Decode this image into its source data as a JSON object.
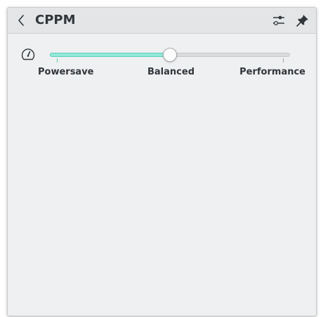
{
  "header": {
    "title": "CPPM",
    "back_icon": "chevron-left-icon",
    "settings_icon": "sliders-icon",
    "pin_icon": "pin-icon"
  },
  "profile_slider": {
    "icon": "speedometer-icon",
    "options": [
      "Powersave",
      "Balanced",
      "Performance"
    ],
    "selected": "Balanced",
    "value_fraction": 0.5,
    "colors": {
      "fill": "#93e8d8",
      "fill_border": "#5ccfb9",
      "track": "#dadcdd",
      "tick_active": "#5ccfb9",
      "tick_inactive": "#9ea2a5"
    }
  }
}
